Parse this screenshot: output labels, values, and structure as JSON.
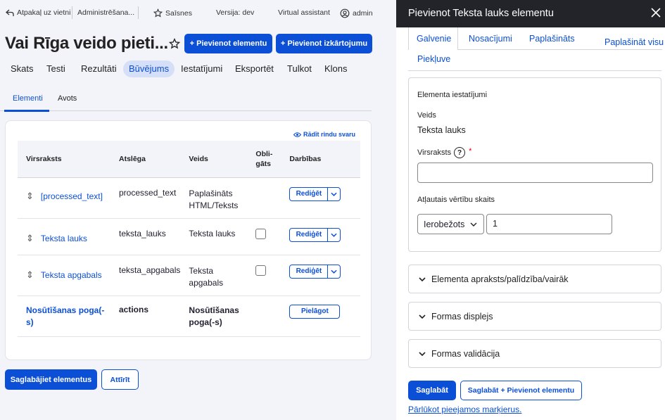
{
  "toolbar": {
    "back_label": "Atpakaļ uz vietni",
    "admin_label": "Administrēšana...",
    "shortcuts_label": "Saīsnes",
    "version_label": "Versija: dev",
    "assistant_label": "Virtual assistant",
    "user_label": "admin"
  },
  "page": {
    "title": "Vai Rīga veido pieti...",
    "add_element_label": "+ Pievienot elementu",
    "add_layout_label": "+ Pievienot izkārtojumu"
  },
  "primary_tabs": [
    "Skats",
    "Testi",
    "Rezultāti",
    "Būvējums",
    "Iestatījumi",
    "Eksportēt",
    "Tulkot",
    "Klons"
  ],
  "primary_active": "Būvējums",
  "secondary_tabs": [
    "Elementi",
    "Avots"
  ],
  "secondary_active": "Elementi",
  "table": {
    "show_weights_label": "Rādīt rindu svaru",
    "headers": {
      "title": "Virsraksts",
      "key": "Atslēga",
      "type": "Veids",
      "required_line1": "Obli-",
      "required_line2": "gāts",
      "operations": "Darbības"
    },
    "rows": [
      {
        "title": "[processed_text]",
        "key": "processed_text",
        "type_line1": "Paplašināts",
        "type_line2": "HTML/Teksts",
        "action": "Rediģēt"
      },
      {
        "title": "Teksta lauks",
        "key": "teksta_lauks",
        "type_line1": "Teksta lauks",
        "type_line2": "",
        "action": "Rediģēt"
      },
      {
        "title": "Teksta apgabals",
        "key": "teksta_apgabals",
        "type_line1": "Teksta",
        "type_line2": "apgabals",
        "action": "Rediģēt"
      }
    ],
    "actions_row": {
      "title_line1": "Nosūtīšanas poga(-",
      "title_line2": "s)",
      "key": "actions",
      "type_line1": "Nosūtīšanas",
      "type_line2": "poga(-s)",
      "action": "Pielāgot"
    }
  },
  "form_actions": {
    "save_label": "Saglabājiet elementus",
    "reset_label": "Attīrīt"
  },
  "dialog": {
    "title": "Pievienot Teksta lauks elementu",
    "tabs": [
      "Galvenie",
      "Nosacījumi",
      "Paplašināts",
      "Piekļuve"
    ],
    "active_tab": "Galvenie",
    "expand_all": "Paplašināt visu",
    "fieldset_title": "Elementa iestatījumi",
    "type_label": "Veids",
    "type_value": "Teksta lauks",
    "title_label": "Virsraksts",
    "title_value": "",
    "title_required_mark": "*",
    "help_icon_glyph": "?",
    "multiple_label": "Atļautais vērtību skaits",
    "multiple_select": "Ierobežots",
    "multiple_value": "1",
    "sections": [
      "Elementa apraksts/palīdzība/vairāk",
      "Formas displejs",
      "Formas validācija"
    ],
    "save_label": "Saglabāt",
    "save_add_label": "Saglabāt + Pievienot elementu",
    "tokens_link": "Pārlūkot pieejamos marķierus."
  },
  "colors": {
    "accent": "#0b4fd6",
    "dialog_header": "#232429",
    "background": "#f3f4f9"
  }
}
